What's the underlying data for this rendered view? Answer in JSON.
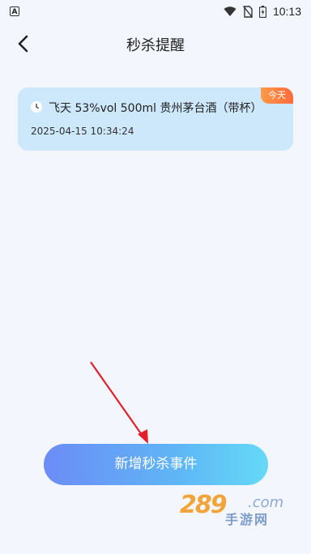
{
  "status_bar": {
    "time": "10:13",
    "icons": [
      "text-icon",
      "wifi-icon",
      "no-sim-icon",
      "battery-icon"
    ]
  },
  "nav": {
    "title": "秒杀提醒",
    "back_icon": "chevron-left-icon"
  },
  "reminders": [
    {
      "badge": "今天",
      "icon": "clock-icon",
      "title": "飞天 53%vol 500ml 贵州茅台酒（带杯）",
      "datetime": "2025-04-15 10:34:24"
    }
  ],
  "actions": {
    "add_label": "新增秒杀事件"
  },
  "annotation": {
    "color": "#e0202a"
  },
  "watermark": {
    "number": "289",
    "suffix": ".com",
    "text": "手游网"
  },
  "colors": {
    "background": "#f3f7fd",
    "card": "#cde7fb",
    "badge": "#ff7a3e",
    "button_start": "#6b8cf6",
    "button_end": "#66d9f7"
  }
}
